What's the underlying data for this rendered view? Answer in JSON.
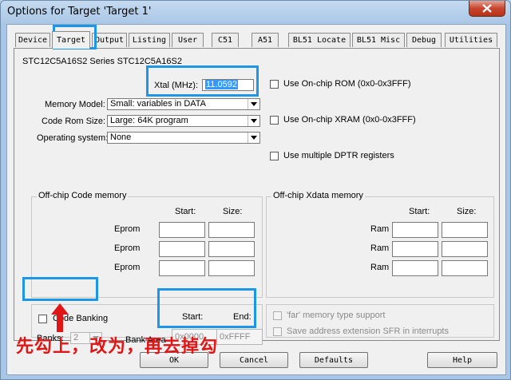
{
  "window": {
    "title": "Options for Target 'Target 1'"
  },
  "tabs": [
    {
      "label": "Device"
    },
    {
      "label": "Target"
    },
    {
      "label": "Output"
    },
    {
      "label": "Listing"
    },
    {
      "label": "User"
    },
    {
      "label": "C51"
    },
    {
      "label": "A51"
    },
    {
      "label": "BL51 Locate"
    },
    {
      "label": "BL51 Misc"
    },
    {
      "label": "Debug"
    },
    {
      "label": "Utilities"
    }
  ],
  "device_name": "STC12C5A16S2 Series STC12C5A16S2",
  "xtal": {
    "label": "Xtal (MHz):",
    "value": "11.0592"
  },
  "memory_model": {
    "label": "Memory Model:",
    "value": "Small: variables in DATA"
  },
  "code_rom_size": {
    "label": "Code Rom Size:",
    "value": "Large: 64K program"
  },
  "operating_system": {
    "label": "Operating system:",
    "value": "None"
  },
  "checks": {
    "onchip_rom": "Use On-chip ROM (0x0-0x3FFF)",
    "onchip_xram": "Use On-chip XRAM (0x0-0x3FFF)",
    "multiple_dptr": "Use multiple DPTR registers",
    "far_memory": "'far' memory type support",
    "save_sfr": "Save address extension SFR in interrupts"
  },
  "offchip_code": {
    "title": "Off-chip Code memory",
    "start_header": "Start:",
    "size_header": "Size:",
    "rows": [
      {
        "label": "Eprom"
      },
      {
        "label": "Eprom"
      },
      {
        "label": "Eprom"
      }
    ]
  },
  "offchip_xdata": {
    "title": "Off-chip Xdata memory",
    "start_header": "Start:",
    "size_header": "Size:",
    "rows": [
      {
        "label": "Ram"
      },
      {
        "label": "Ram"
      },
      {
        "label": "Ram"
      }
    ]
  },
  "code_banking": {
    "label": "Code Banking",
    "banks_label": "Banks:",
    "banks_value": "2",
    "bank_area_label": "Bank Area",
    "start_header": "Start:",
    "end_header": "End:",
    "start_value": "0x0000",
    "end_value": "0xFFFF"
  },
  "buttons": {
    "ok": "OK",
    "cancel": "Cancel",
    "defaults": "Defaults",
    "help": "Help"
  },
  "annotation": "先勾上，改为，再去掉勾",
  "colors": {
    "highlight": "#1e96e8",
    "annotation": "#e01515"
  }
}
